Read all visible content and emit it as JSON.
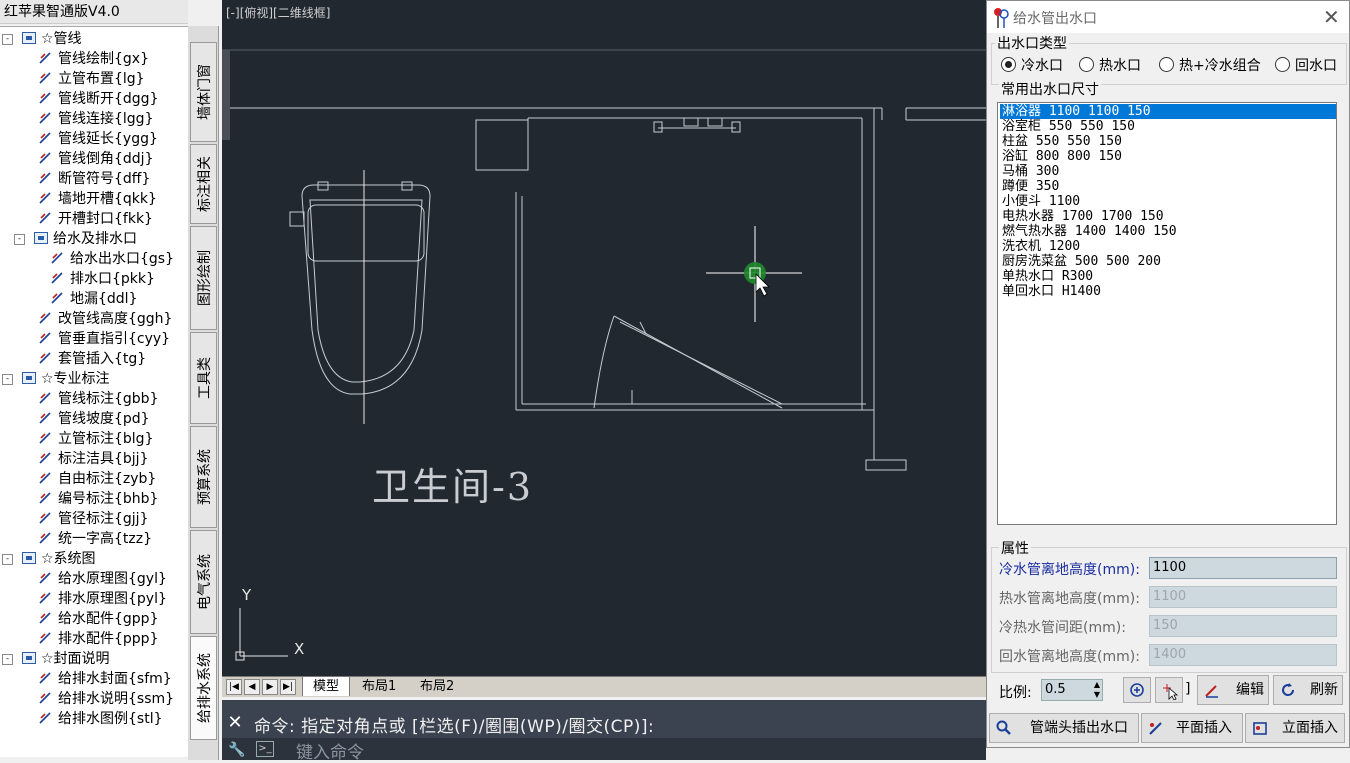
{
  "app_title": "红苹果智通版V4.0",
  "tree": [
    {
      "level": 0,
      "label": "☆管线",
      "icon": "folder-icon",
      "expander": "-"
    },
    {
      "level": 1,
      "label": "管线绘制{gx}",
      "icon": "pipe-draw-icon"
    },
    {
      "level": 1,
      "label": "立管布置{lg}",
      "icon": "riser-icon"
    },
    {
      "level": 1,
      "label": "管线断开{dgg}",
      "icon": "pipe-break-icon"
    },
    {
      "level": 1,
      "label": "管线连接{lgg}",
      "icon": "pipe-connect-icon"
    },
    {
      "level": 1,
      "label": "管线延长{ygg}",
      "icon": "pipe-extend-icon"
    },
    {
      "level": 1,
      "label": "管线倒角{ddj}",
      "icon": "pipe-chamfer-icon"
    },
    {
      "level": 1,
      "label": "断管符号{dff}",
      "icon": "break-symbol-icon"
    },
    {
      "level": 1,
      "label": "墙地开槽{qkk}",
      "icon": "groove-icon"
    },
    {
      "level": 1,
      "label": "开槽封口{fkk}",
      "icon": "groove-seal-icon"
    },
    {
      "level": 1,
      "label": "给水及排水口",
      "icon": "folder-icon",
      "expander": "-"
    },
    {
      "level": 2,
      "label": "给水出水口{gs}",
      "icon": "water-outlet-icon"
    },
    {
      "level": 2,
      "label": "排水口{pkk}",
      "icon": "drain-icon"
    },
    {
      "level": 2,
      "label": "地漏{ddl}",
      "icon": "floor-drain-icon"
    },
    {
      "level": 1,
      "label": "改管线高度{ggh}",
      "icon": "pipe-height-icon"
    },
    {
      "level": 1,
      "label": "管垂直指引{cyy}",
      "icon": "pipe-leader-icon"
    },
    {
      "level": 1,
      "label": "套管插入{tg}",
      "icon": "sleeve-icon"
    },
    {
      "level": 0,
      "label": "☆专业标注",
      "icon": "folder-icon",
      "expander": "-"
    },
    {
      "level": 1,
      "label": "管线标注{gbb}",
      "icon": "pipe-label-icon"
    },
    {
      "level": 1,
      "label": "管线坡度{pd}",
      "icon": "pipe-slope-icon"
    },
    {
      "level": 1,
      "label": "立管标注{blg}",
      "icon": "riser-label-icon"
    },
    {
      "level": 1,
      "label": "标注洁具{bjj}",
      "icon": "fixture-label-icon"
    },
    {
      "level": 1,
      "label": "自由标注{zyb}",
      "icon": "free-label-icon"
    },
    {
      "level": 1,
      "label": "编号标注{bhb}",
      "icon": "number-label-icon"
    },
    {
      "level": 1,
      "label": "管径标注{gjj}",
      "icon": "diameter-label-icon"
    },
    {
      "level": 1,
      "label": "统一字高{tzz}",
      "icon": "text-height-icon"
    },
    {
      "level": 0,
      "label": "☆系统图",
      "icon": "folder-icon",
      "expander": "-"
    },
    {
      "level": 1,
      "label": "给水原理图{gyl}",
      "icon": "supply-diagram-icon"
    },
    {
      "level": 1,
      "label": "排水原理图{pyl}",
      "icon": "drain-diagram-icon"
    },
    {
      "level": 1,
      "label": "给水配件{gpp}",
      "icon": "supply-fitting-icon"
    },
    {
      "level": 1,
      "label": "排水配件{ppp}",
      "icon": "drain-fitting-icon"
    },
    {
      "level": 0,
      "label": "☆封面说明",
      "icon": "folder-icon",
      "expander": "-"
    },
    {
      "level": 1,
      "label": "给排水封面{sfm}",
      "icon": "cover-icon"
    },
    {
      "level": 1,
      "label": "给排水说明{ssm}",
      "icon": "notes-icon"
    },
    {
      "level": 1,
      "label": "给排水图例{stl}",
      "icon": "legend-icon"
    }
  ],
  "vertical_tabs": [
    "墙体门窗",
    "标注相关",
    "图形绘制",
    "工具类",
    "预算系统",
    "电气系统",
    "给排水系统"
  ],
  "active_vertical_tab": "给排水系统",
  "viewport_label": "[-][俯视][二维线框]",
  "drawing": {
    "room_label": "卫生间-3",
    "axis_y": "Y",
    "axis_x": "X"
  },
  "layout_tabs": [
    "模型",
    "布局1",
    "布局2"
  ],
  "active_layout_tab": "模型",
  "command": {
    "history": "命令: 指定对角点或 [栏选(F)/圈围(WP)/圈交(CP)]:",
    "placeholder": "键入命令",
    "close": "✕"
  },
  "dialog": {
    "title": "给水管出水口",
    "close": "✕",
    "outlet_type_label": "出水口类型",
    "outlet_types": [
      "冷水口",
      "热水口",
      "热+冷水组合",
      "回水口"
    ],
    "selected_outlet_type": "冷水口",
    "sizes_label": "常用出水口尺寸",
    "sizes": [
      "淋浴器 1100 1100 150",
      "浴室柜 550 550 150",
      "柱盆 550 550 150",
      "浴缸 800 800 150",
      "马桶 300",
      "蹲便 350",
      "小便斗 1100",
      "电热水器 1700 1700 150",
      "燃气热水器 1400 1400 150",
      "洗衣机 1200",
      "厨房洗菜盆 500 500 200",
      "单热水口 R300",
      "单回水口 H1400"
    ],
    "selected_size": "淋浴器 1100 1100 150",
    "properties_label": "属性",
    "properties": [
      {
        "label": "冷水管离地高度(mm):",
        "value": "1100",
        "active": true
      },
      {
        "label": "热水管离地高度(mm):",
        "value": "1100",
        "active": false
      },
      {
        "label": "冷热水管间距(mm):",
        "value": "150",
        "active": false
      },
      {
        "label": "回水管离地高度(mm):",
        "value": "1400",
        "active": false
      }
    ],
    "scale_label": "比例:",
    "scale_value": "0.5",
    "edit_button": "编辑",
    "refresh_button": "刷新",
    "insert_at_pipe_end_button": "管端头插出水口",
    "plan_insert_button": "平面插入",
    "elevation_insert_button": "立面插入",
    "colors": {
      "selection": "#0078d7",
      "canvas": "#212830",
      "active_label": "#1a2ea0"
    }
  }
}
